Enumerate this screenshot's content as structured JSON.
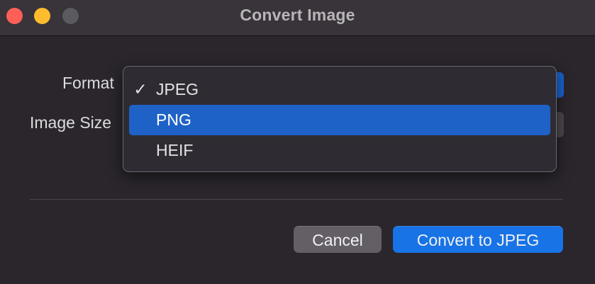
{
  "window": {
    "title": "Convert Image",
    "traffic_lights": {
      "close_color": "#fe5f57",
      "minimize_color": "#febc2e",
      "zoom_color": "#5b5a5e"
    }
  },
  "form": {
    "format_label": "Format",
    "image_size_label": "Image Size"
  },
  "format_menu": {
    "open": true,
    "selected": "JPEG",
    "highlighted": "PNG",
    "check_glyph": "✓",
    "items": [
      {
        "label": "JPEG",
        "checked": true,
        "highlighted": false
      },
      {
        "label": "PNG",
        "checked": false,
        "highlighted": true
      },
      {
        "label": "HEIF",
        "checked": false,
        "highlighted": false
      }
    ]
  },
  "buttons": {
    "cancel_label": "Cancel",
    "convert_label": "Convert to JPEG"
  },
  "colors": {
    "accent": "#1773e6",
    "highlight": "#1f62c7"
  }
}
